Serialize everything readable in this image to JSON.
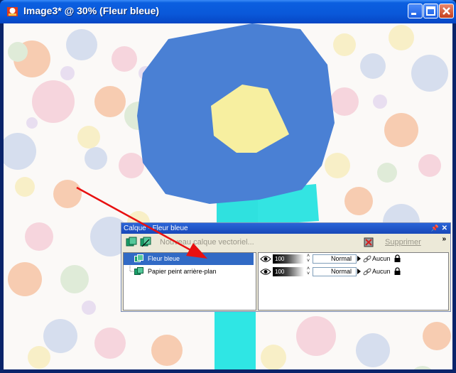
{
  "window": {
    "title": "Image3* @  30% (Fleur bleue)",
    "controls": [
      "minimize",
      "maximize",
      "close"
    ]
  },
  "palette": {
    "title": "Calque - Fleur bleue",
    "toolbar": {
      "new_vector_layer_label": "Nouveau calque vectoriel...",
      "delete_label": "Supprimer",
      "more": "»"
    },
    "layers": [
      {
        "name": "Fleur bleue",
        "selected": true,
        "opacity": "100",
        "blend_mode": "Normal",
        "group": "Aucun"
      },
      {
        "name": "Papier peint arrière-plan",
        "selected": false,
        "opacity": "100",
        "blend_mode": "Normal",
        "group": "Aucun"
      }
    ]
  },
  "colors": {
    "titlebar": "#0a58d9",
    "selection": "#316ac5",
    "flower_disc": "#4a80d4",
    "flower_center": "#f7efa0",
    "stem": "#2fe1df",
    "arrow": "#e81010"
  }
}
